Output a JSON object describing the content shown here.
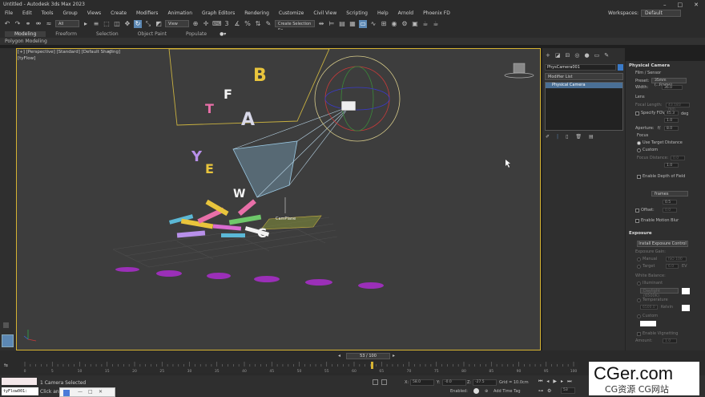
{
  "window": {
    "title": "Untitled - Autodesk 3ds Max 2023"
  },
  "menu": [
    "File",
    "Edit",
    "Tools",
    "Group",
    "Views",
    "Create",
    "Modifiers",
    "Animation",
    "Graph Editors",
    "Rendering",
    "Customize",
    "Civil View",
    "Scripting",
    "Help",
    "Arnold",
    "Phoenix FD"
  ],
  "workspaces": {
    "label": "Workspaces:",
    "value": "Default"
  },
  "toolbar": {
    "selection_filter": "All",
    "ref_coord": "View",
    "named_selection": "Create Selection Se"
  },
  "ribbon": {
    "tabs": [
      "Modeling",
      "Freeform",
      "Selection",
      "Object Paint",
      "Populate"
    ],
    "sub_label": "Polygon Modeling"
  },
  "viewport": {
    "label": "[+] [Perspective] [Standard] [Default Shading]",
    "label2": "[tyFlow]",
    "plane_label": "CamPlane",
    "letters": [
      "B",
      "A",
      "F",
      "T",
      "Y",
      "E",
      "W",
      "C"
    ]
  },
  "command_panel": {
    "object_name": "PhysCamera001",
    "modifier_list": "Modifier List",
    "stack_item": "Physical Camera"
  },
  "rollout": {
    "title": "Physical Camera",
    "film_sensor": "Film / Sensor",
    "preset_label": "Preset:",
    "preset_value": "35mm (...Frame)",
    "width_label": "Width:",
    "width_value": "36.0",
    "lens": "Lens",
    "focal_label": "Focal Length:",
    "focal_value": "43.183 mm",
    "specify_fov": "Specify FOV:",
    "fov_value": "45.3",
    "fov_unit": "deg",
    "zoom_value": "1.0",
    "aperture_label": "Aperture:",
    "aperture_f": "f/",
    "aperture_value": "8.0",
    "focus": "Focus",
    "use_target": "Use Target Distance",
    "custom": "Custom",
    "focus_dist_label": "Focus Distance:",
    "focus_dist_value": "0.0",
    "focus_mult": "1.0",
    "dof": "Enable Depth of Field",
    "shutter_type": "frames",
    "shutter_value": "0.5",
    "offset_label": "Offset:",
    "offset_value": "0.0",
    "motion_blur": "Enable Motion Blur",
    "exposure_title": "Exposure",
    "install_btn": "Install Exposure Control",
    "exposure_gain": "Exposure Gain:",
    "manual": "Manual",
    "manual_value": "ISO 100",
    "target": "Target",
    "target_value": "6.0",
    "ev": "EV",
    "white_balance": "White Balance:",
    "illuminant": "Illuminant",
    "illum_value": "Daylight (6500K)",
    "temperature": "Temperature",
    "temp_value": "6500.0",
    "temp_unit": "Kelvin",
    "custom2": "Custom",
    "vignetting": "Enable Vignetting",
    "amount_label": "Amount:",
    "amount_value": "1.0"
  },
  "timeline": {
    "slider": "53 / 100",
    "ticks": [
      "0",
      "5",
      "10",
      "15",
      "20",
      "25",
      "30",
      "35",
      "40",
      "45",
      "50",
      "55",
      "60",
      "65",
      "70",
      "75",
      "80",
      "85",
      "90",
      "95",
      "100"
    ]
  },
  "status": {
    "selected": "1 Camera Selected",
    "hint": "Click and d",
    "script": "tyFlow001:",
    "x_label": "X:",
    "x_value": "58.0",
    "y_label": "Y:",
    "y_value": "-0.0",
    "z_label": "Z:",
    "z_value": "-27.5",
    "grid": "Grid = 10.0cm",
    "enabled": "Enabled:",
    "add_time_tag": "Add Time Tag",
    "frame": "53"
  },
  "watermark": {
    "big": "CGer.com",
    "small": "CG资源 CG网站"
  }
}
